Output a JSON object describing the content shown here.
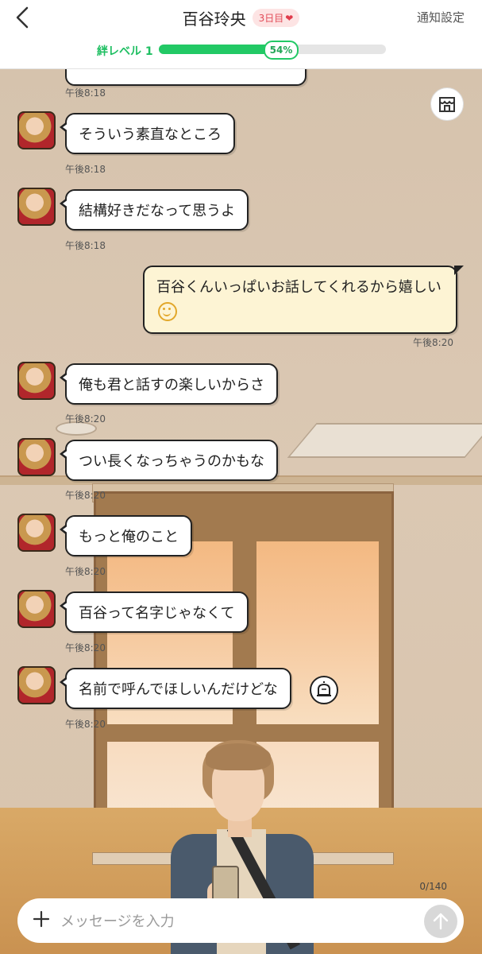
{
  "header": {
    "title": "百谷玲央",
    "day_badge": "3日目",
    "notification_settings": "通知設定",
    "bond_label": "絆レベル 1",
    "bond_percent_text": "54%",
    "bond_progress": 0.54
  },
  "messages": [
    {
      "from": "other",
      "text": "そういう素直なところ",
      "time": "午後8:18"
    },
    {
      "from": "other",
      "text": "結構好きだなって思うよ",
      "time": "午後8:18"
    },
    {
      "from": "me",
      "text": "百谷くんいっぱいお話してくれるから嬉しい",
      "time": "午後8:20"
    },
    {
      "from": "other",
      "text": "俺も君と話すの楽しいからさ",
      "time": "午後8:20"
    },
    {
      "from": "other",
      "text": "つい長くなっちゃうのかもな",
      "time": "午後8:20"
    },
    {
      "from": "other",
      "text": "もっと俺のこと",
      "time": "午後8:20"
    },
    {
      "from": "other",
      "text": "百谷って名字じゃなくて",
      "time": "午後8:20"
    },
    {
      "from": "other",
      "text": "名前で呼んでほしいんだけどな",
      "time": "午後8:20"
    }
  ],
  "partial_top_time": "午後8:18",
  "composer": {
    "placeholder": "メッセージを入力",
    "value": "",
    "counter": "0/140"
  },
  "icons": {
    "back": "chevron-left-icon",
    "heart": "heart-icon",
    "shop": "shop-icon",
    "alarm": "alarm-icon",
    "plus": "plus-icon",
    "send": "arrow-up-icon"
  },
  "colors": {
    "accent_green": "#22c965",
    "badge_red": "#e24b58",
    "outgoing_bubble": "#fdf4d4"
  }
}
